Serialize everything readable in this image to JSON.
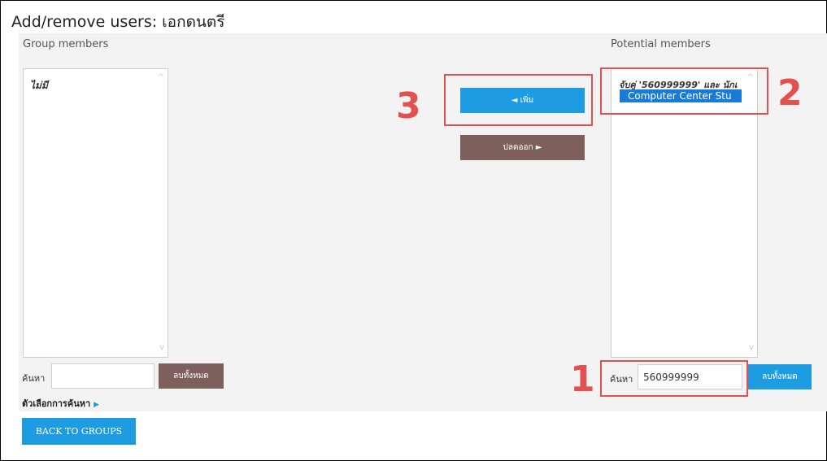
{
  "page": {
    "title": "Add/remove users: เอกดนตรี"
  },
  "group_members": {
    "heading": "Group members",
    "none_label": "ไม่มี",
    "search_label": "ค้นหา",
    "search_value": "",
    "clear_label": "ลบทั้งหมด",
    "search_options_label": "ตัวเลือกการค้นหา",
    "search_options_icon": "triangle-right-icon"
  },
  "actions": {
    "add_label": "◄ เพิ่ม",
    "remove_label": "ปลดออก ►"
  },
  "potential_members": {
    "heading": "Potential members",
    "match_group_label": "จับคู่ '560999999' และ นักเ",
    "selected_option": "Computer Center Stu",
    "search_label": "ค้นหา",
    "search_value": "560999999",
    "clear_label": "ลบทั้งหมด"
  },
  "annotations": {
    "step_1": "1",
    "step_2": "2",
    "step_3": "3",
    "color": "#e3504f"
  },
  "footer": {
    "back_label": "BACK TO GROUPS"
  },
  "colors": {
    "accent_blue": "#1e9ce2",
    "button_brown": "#7d5f5b",
    "selection_blue": "#1a7bd6",
    "panel_gray": "#f3f3f3"
  }
}
